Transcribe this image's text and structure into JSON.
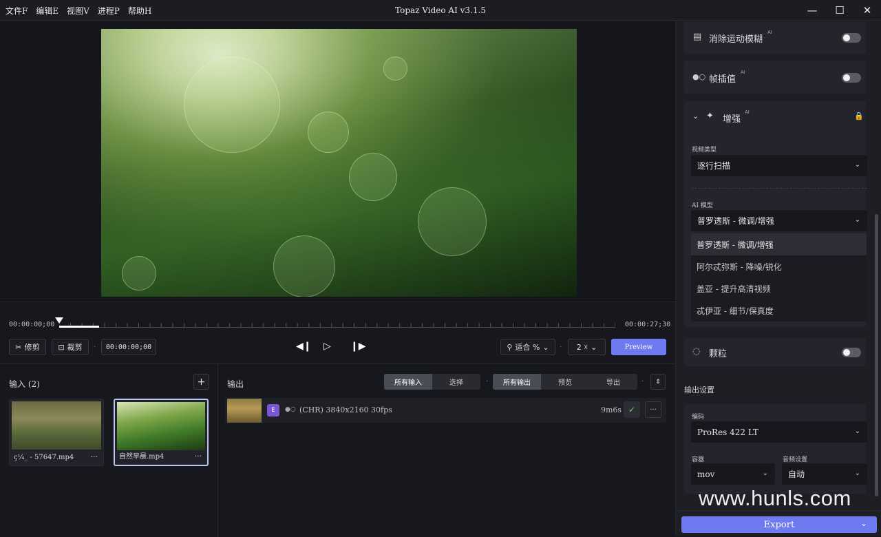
{
  "menu": [
    "文件F",
    "编辑E",
    "视图V",
    "进程P",
    "帮助H"
  ],
  "window_title": "Topaz Video AI  v3.1.5",
  "timeline": {
    "start": "00:00:00;00",
    "end": "00:00:27;30",
    "current": "00:00:00;00"
  },
  "controls": {
    "trim": "修剪",
    "crop": "裁剪",
    "zoom": "适合 %",
    "speed": "2 ☓",
    "preview": "Preview"
  },
  "input": {
    "title": "输入 (2)",
    "add": "+",
    "items": [
      {
        "name": "ç¼_ - 57647.mp4",
        "more": "···"
      },
      {
        "name": "自然早晨.mp4",
        "more": "···"
      }
    ]
  },
  "output": {
    "title": "输出",
    "seg1": [
      "所有输入",
      "选择"
    ],
    "seg2": [
      "所有输出",
      "预览",
      "导出"
    ],
    "row": {
      "badge": "E",
      "meta": "(CHR) 3840x2160 30fps",
      "time": "9m6s",
      "check": "✓",
      "more": "···"
    }
  },
  "right": {
    "motion_blur": "消除运动模糊",
    "ai_sup": "AI",
    "frame_interp": "帧插值",
    "enhance": "增强",
    "video_type_label": "视频类型",
    "video_type": "逐行扫描",
    "ai_model_label": "AI 模型",
    "ai_model": "普罗透斯 - 微调/增强",
    "model_options": [
      "普罗透斯 - 微调/增强",
      "阿尔忒弥斯 - 降噪/锐化",
      "盖亚 - 提升高清视频",
      "忒伊亚 - 细节/保真度"
    ],
    "grain": "颗粒",
    "output_settings": "输出设置",
    "codec_label": "编码",
    "codec": "ProRes 422 LT",
    "container_label": "容器",
    "container": "mov",
    "audio_label": "音频设置",
    "audio": "自动"
  },
  "export": "Export",
  "watermark": "www.hunls.com",
  "colors": {
    "accent": "#6f79f0",
    "bg": "#16171c",
    "panel": "#24252c"
  }
}
